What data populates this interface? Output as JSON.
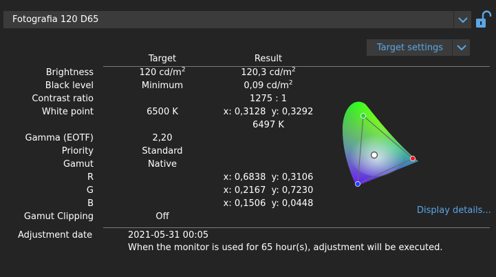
{
  "preset": {
    "name": "Fotografia 120 D65"
  },
  "icons": {
    "preset_dropdown": "chevron-down-icon",
    "lock": "unlock-icon",
    "target_dropdown": "chevron-down-icon"
  },
  "target_settings": {
    "label": "Target settings"
  },
  "columns": {
    "target": "Target",
    "result": "Result"
  },
  "rows": [
    {
      "label": "Brightness",
      "target": "120 cd/m",
      "target_sup": "2",
      "result": "120,3 cd/m",
      "result_sup": "2"
    },
    {
      "label": "Black level",
      "target": "Minimum",
      "target_sup": "",
      "result": "0,09 cd/m",
      "result_sup": "2"
    },
    {
      "label": "Contrast ratio",
      "target": "",
      "target_sup": "",
      "result": "1275 : 1",
      "result_sup": ""
    },
    {
      "label": "White point",
      "target": "6500 K",
      "target_sup": "",
      "result": "x: 0,3128  y: 0,3292",
      "result_sup": ""
    },
    {
      "label": "",
      "target": "",
      "target_sup": "",
      "result": "6497 K",
      "result_sup": ""
    },
    {
      "label": "Gamma (EOTF)",
      "target": "2,20",
      "target_sup": "",
      "result": "",
      "result_sup": ""
    },
    {
      "label": "Priority",
      "target": "Standard",
      "target_sup": "",
      "result": "",
      "result_sup": ""
    },
    {
      "label": "Gamut",
      "target": "Native",
      "target_sup": "",
      "result": "",
      "result_sup": ""
    },
    {
      "label": "R",
      "target": "",
      "target_sup": "",
      "result": "x: 0,6838  y: 0,3106",
      "result_sup": ""
    },
    {
      "label": "G",
      "target": "",
      "target_sup": "",
      "result": "x: 0,2167  y: 0,7230",
      "result_sup": ""
    },
    {
      "label": "B",
      "target": "",
      "target_sup": "",
      "result": "x: 0,1506  y: 0,0448",
      "result_sup": ""
    },
    {
      "label": "Gamut Clipping",
      "target": "Off",
      "target_sup": "",
      "result": "",
      "result_sup": ""
    }
  ],
  "display_details": {
    "label": "Display details..."
  },
  "adjustment": {
    "label": "Adjustment date",
    "date": "2021-05-31 00:05",
    "note": "When the monitor is used for 65 hour(s), adjustment will be executed."
  },
  "colors": {
    "background": "#242424",
    "panel": "#3b3b3b",
    "accent": "#5aa7e6",
    "text": "#ffffff"
  }
}
